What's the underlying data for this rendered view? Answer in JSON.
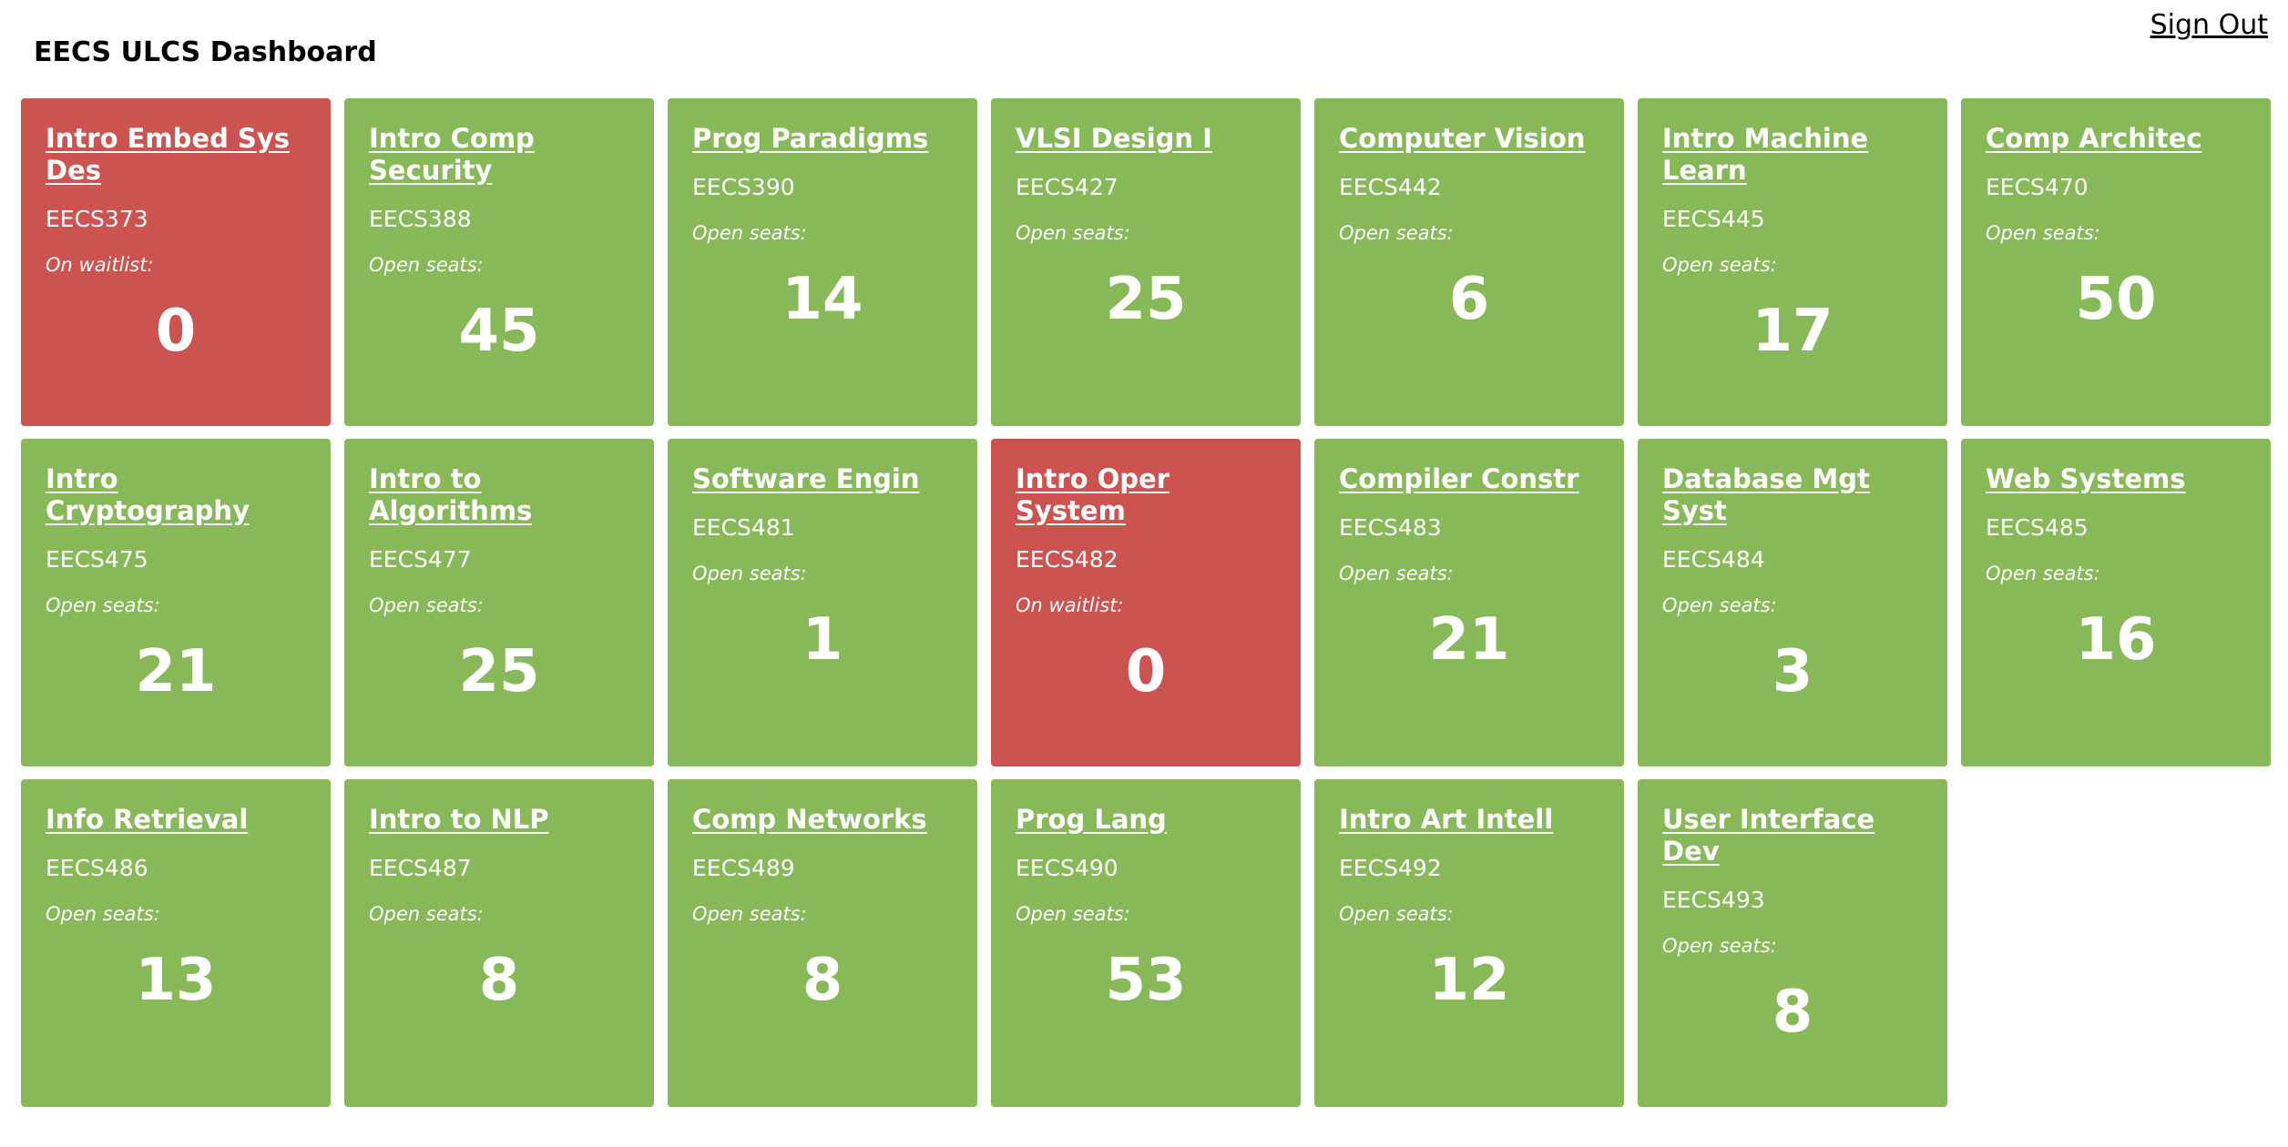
{
  "header": {
    "title": "EECS ULCS Dashboard",
    "sign_out": "Sign Out"
  },
  "colors": {
    "open": "#88b959",
    "waitlist": "#cc5350"
  },
  "courses": [
    {
      "name": "Intro Embed Sys Des",
      "code": "EECS373",
      "label": "On waitlist:",
      "count": 0,
      "status": "waitlist"
    },
    {
      "name": "Intro Comp Security",
      "code": "EECS388",
      "label": "Open seats:",
      "count": 45,
      "status": "open"
    },
    {
      "name": "Prog Paradigms",
      "code": "EECS390",
      "label": "Open seats:",
      "count": 14,
      "status": "open"
    },
    {
      "name": "VLSI Design I",
      "code": "EECS427",
      "label": "Open seats:",
      "count": 25,
      "status": "open"
    },
    {
      "name": "Computer Vision",
      "code": "EECS442",
      "label": "Open seats:",
      "count": 6,
      "status": "open"
    },
    {
      "name": "Intro Machine Learn",
      "code": "EECS445",
      "label": "Open seats:",
      "count": 17,
      "status": "open"
    },
    {
      "name": "Comp Architec",
      "code": "EECS470",
      "label": "Open seats:",
      "count": 50,
      "status": "open"
    },
    {
      "name": "Intro Cryptography",
      "code": "EECS475",
      "label": "Open seats:",
      "count": 21,
      "status": "open"
    },
    {
      "name": "Intro to Algorithms",
      "code": "EECS477",
      "label": "Open seats:",
      "count": 25,
      "status": "open"
    },
    {
      "name": "Software Engin",
      "code": "EECS481",
      "label": "Open seats:",
      "count": 1,
      "status": "open"
    },
    {
      "name": "Intro Oper System",
      "code": "EECS482",
      "label": "On waitlist:",
      "count": 0,
      "status": "waitlist"
    },
    {
      "name": "Compiler Constr",
      "code": "EECS483",
      "label": "Open seats:",
      "count": 21,
      "status": "open"
    },
    {
      "name": "Database Mgt Syst",
      "code": "EECS484",
      "label": "Open seats:",
      "count": 3,
      "status": "open"
    },
    {
      "name": "Web Systems",
      "code": "EECS485",
      "label": "Open seats:",
      "count": 16,
      "status": "open"
    },
    {
      "name": "Info Retrieval",
      "code": "EECS486",
      "label": "Open seats:",
      "count": 13,
      "status": "open"
    },
    {
      "name": "Intro to NLP",
      "code": "EECS487",
      "label": "Open seats:",
      "count": 8,
      "status": "open"
    },
    {
      "name": "Comp Networks",
      "code": "EECS489",
      "label": "Open seats:",
      "count": 8,
      "status": "open"
    },
    {
      "name": "Prog Lang",
      "code": "EECS490",
      "label": "Open seats:",
      "count": 53,
      "status": "open"
    },
    {
      "name": "Intro Art Intell",
      "code": "EECS492",
      "label": "Open seats:",
      "count": 12,
      "status": "open"
    },
    {
      "name": "User Interface Dev",
      "code": "EECS493",
      "label": "Open seats:",
      "count": 8,
      "status": "open"
    }
  ]
}
